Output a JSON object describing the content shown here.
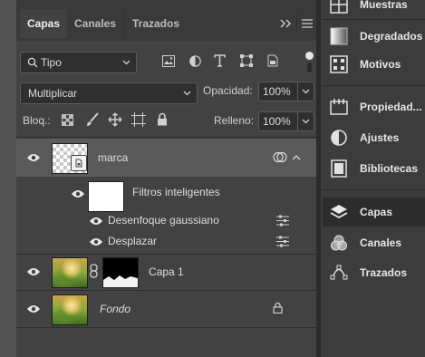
{
  "tabs": [
    {
      "label": "Capas"
    },
    {
      "label": "Canales"
    },
    {
      "label": "Trazados"
    }
  ],
  "filter": {
    "kind": "Tipo"
  },
  "blend": {
    "mode": "Multiplicar"
  },
  "opacity": {
    "label": "Opacidad:",
    "value": "100%"
  },
  "fill": {
    "label": "Relleno:",
    "value": "100%"
  },
  "lock": {
    "label": "Bloq.:"
  },
  "layers": {
    "marca": {
      "name": "marca"
    },
    "smart_filters": {
      "label": "Filtros inteligentes"
    },
    "filter1": {
      "name": "Desenfoque gaussiano"
    },
    "filter2": {
      "name": "Desplazar"
    },
    "capa1": {
      "name": "Capa 1"
    },
    "fondo": {
      "name": "Fondo"
    }
  },
  "dock": {
    "items": [
      {
        "label": "Muestras"
      },
      {
        "label": "Degradados"
      },
      {
        "label": "Motivos"
      },
      {
        "label": "Propiedad..."
      },
      {
        "label": "Ajustes"
      },
      {
        "label": "Bibliotecas"
      },
      {
        "label": "Capas"
      },
      {
        "label": "Canales"
      },
      {
        "label": "Trazados"
      }
    ]
  }
}
